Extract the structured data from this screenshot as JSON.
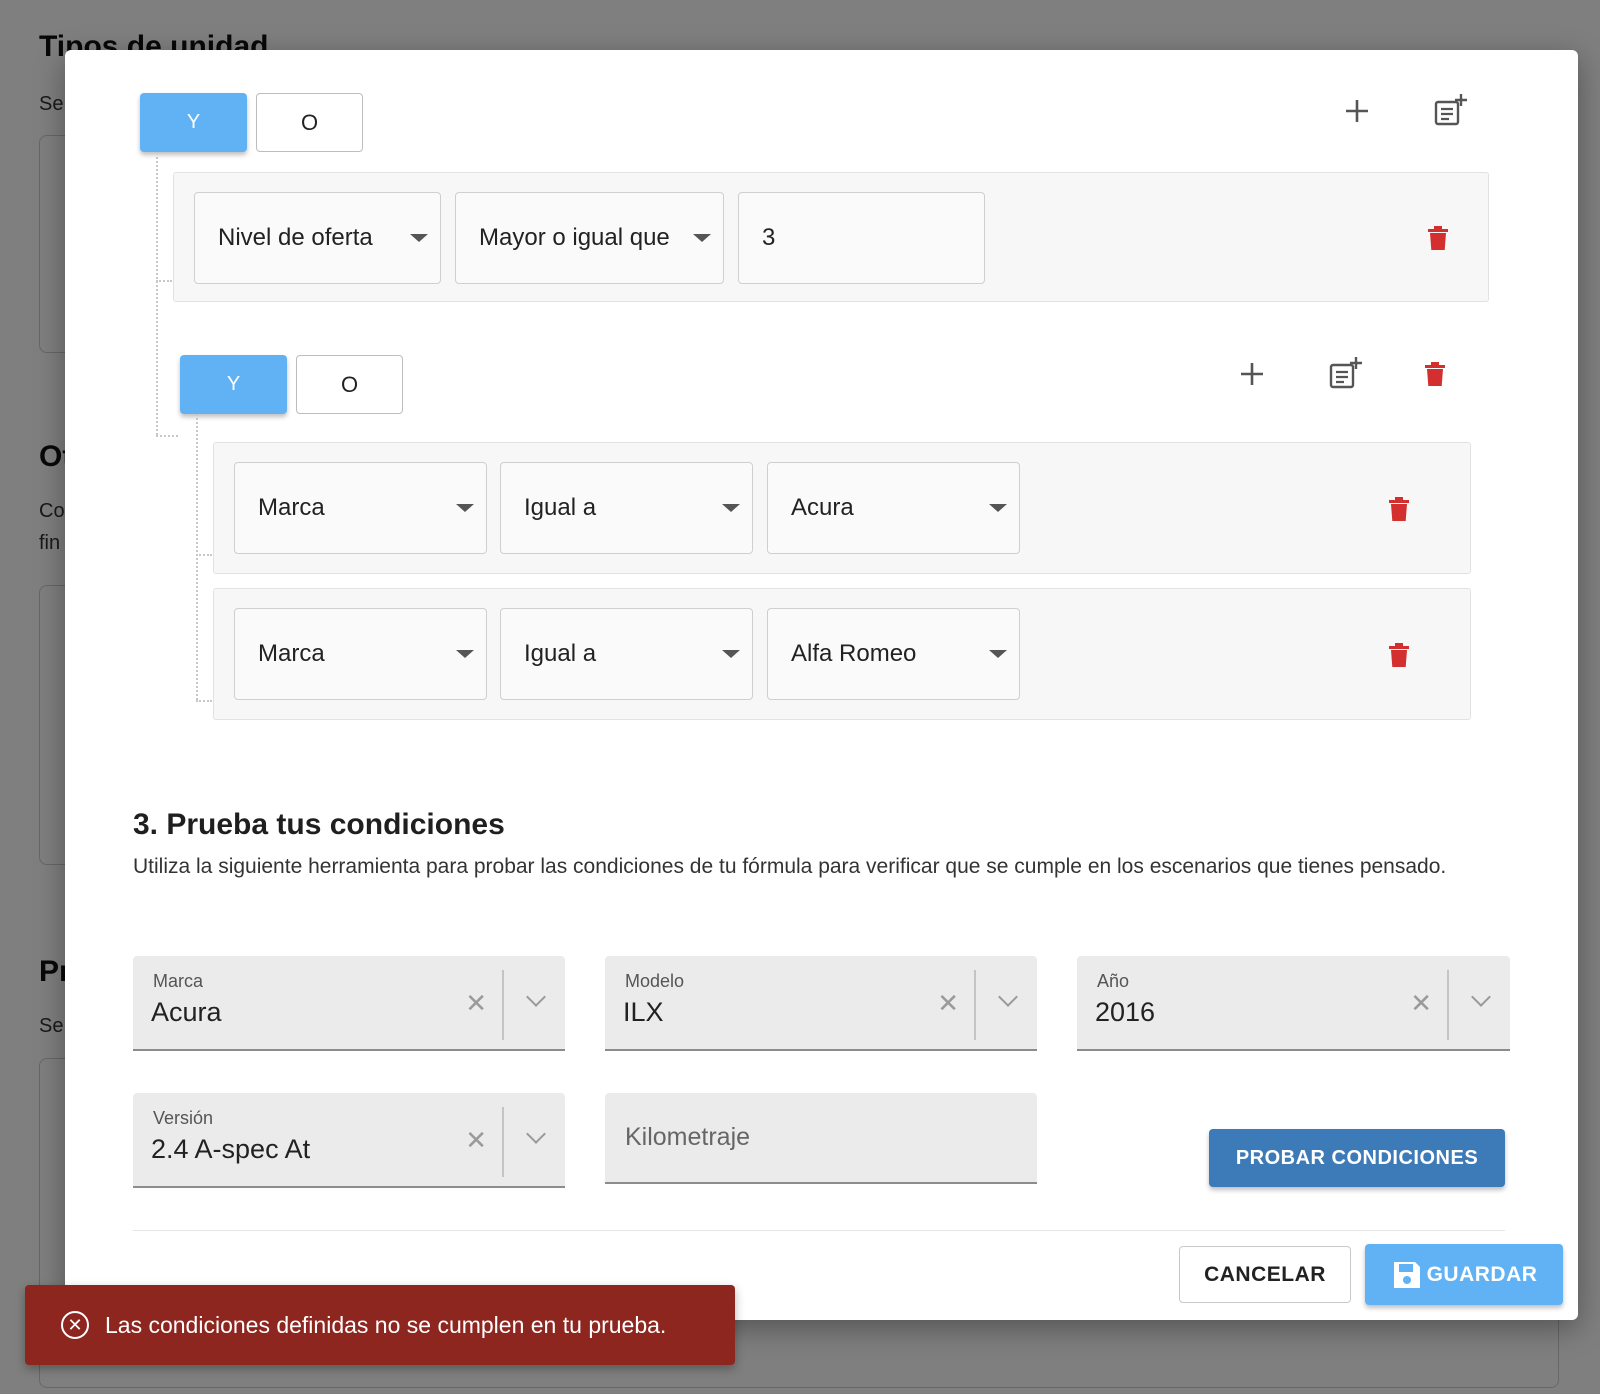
{
  "background": {
    "title": "Tipos de unidad",
    "fragments": [
      "Se",
      "Ot",
      "Co",
      "fin",
      "Pr",
      "Se"
    ]
  },
  "rules": {
    "group1": {
      "and_label": "Y",
      "or_label": "O",
      "row1": {
        "field": "Nivel de oferta",
        "operator": "Mayor o igual que",
        "value": "3"
      }
    },
    "group2": {
      "and_label": "Y",
      "or_label": "O",
      "row1": {
        "field": "Marca",
        "operator": "Igual a",
        "value": "Acura"
      },
      "row2": {
        "field": "Marca",
        "operator": "Igual a",
        "value": "Alfa Romeo"
      }
    }
  },
  "test_section": {
    "title": "3. Prueba tus condiciones",
    "description": "Utiliza la siguiente herramienta para probar las condiciones de tu fórmula para verificar que se cumple en los escenarios que tienes pensado.",
    "fields": {
      "marca": {
        "label": "Marca",
        "value": "Acura"
      },
      "modelo": {
        "label": "Modelo",
        "value": "ILX"
      },
      "anio": {
        "label": "Año",
        "value": "2016"
      },
      "version": {
        "label": "Versión",
        "value": "2.4 A-spec At"
      },
      "kilometraje": {
        "placeholder": "Kilometraje"
      }
    },
    "test_button": "PROBAR CONDICIONES"
  },
  "footer": {
    "cancel": "CANCELAR",
    "save": "GUARDAR"
  },
  "toast": {
    "message": "Las condiciones definidas no se cumplen en tu prueba."
  },
  "icons": {
    "add": "plus-icon",
    "add_group": "note-plus-icon",
    "delete": "trash-icon",
    "save": "floppy-icon",
    "error": "circle-x-icon"
  },
  "colors": {
    "primary_light": "#61b2f5",
    "primary": "#3d7ab8",
    "danger": "#d32f2f",
    "toast": "#8e2620"
  }
}
